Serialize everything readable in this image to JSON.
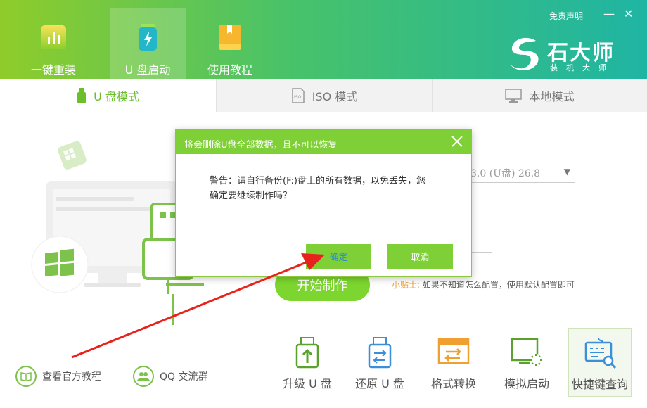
{
  "header": {
    "nav_tabs": [
      {
        "label": "一键重装",
        "icon": "bar-chart-icon"
      },
      {
        "label": "U 盘启动",
        "icon": "usb-drive-icon"
      },
      {
        "label": "使用教程",
        "icon": "book-icon"
      }
    ],
    "disclaimer_link": "免责声明",
    "minimize_symbol": "—",
    "close_symbol": "✕",
    "brand": {
      "name": "石大师",
      "subtitle": "装机大师"
    }
  },
  "mode_tabs": [
    {
      "label": "U 盘模式",
      "icon": "usb-stick-icon",
      "active": true
    },
    {
      "label": "ISO 模式",
      "icon": "iso-file-icon",
      "active": false
    },
    {
      "label": "本地模式",
      "icon": "monitor-icon",
      "active": false
    }
  ],
  "main": {
    "disk_select_value": "3.0 (U盘) 26.8",
    "start_button": "开始制作",
    "tip_key": "小贴士:",
    "tip_text": "如果不知道怎么配置，使用默认配置即可"
  },
  "bottom_links": [
    {
      "label": "查看官方教程",
      "icon": "book-icon"
    },
    {
      "label": "QQ 交流群",
      "icon": "users-icon"
    }
  ],
  "tools": [
    {
      "label": "升级 U 盘",
      "icon": "usb-upgrade-icon"
    },
    {
      "label": "还原 U 盘",
      "icon": "usb-restore-icon"
    },
    {
      "label": "格式转换",
      "icon": "format-convert-icon"
    },
    {
      "label": "模拟启动",
      "icon": "simulate-boot-icon"
    },
    {
      "label": "快捷键查询",
      "icon": "keyboard-search-icon"
    }
  ],
  "dialog": {
    "title": "将会删除U盘全部数据，且不可以恢复",
    "message_line1": "警告：请自行备份(F:)盘上的所有数据，以免丢失，您",
    "message_line2": "确定要继续制作吗？",
    "confirm_label": "确定",
    "cancel_label": "取消"
  },
  "colors": {
    "accent_green": "#7ed036",
    "header_start": "#8fcc2a",
    "header_end": "#1fb5a4",
    "arrow_red": "#e8231e"
  }
}
